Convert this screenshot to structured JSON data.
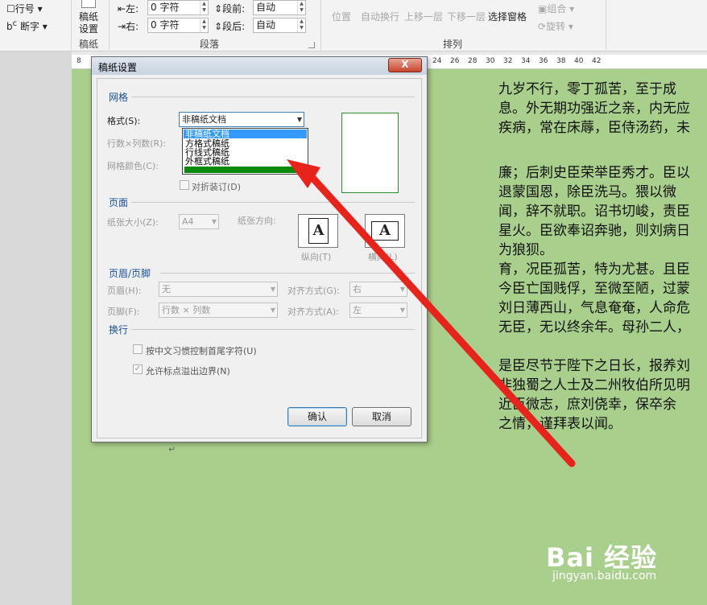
{
  "ribbon": {
    "line_num": "行号",
    "hyphen": "断字",
    "paper_btn_line1": "稿纸",
    "paper_btn_line2": "设置",
    "indent_left_label": "左:",
    "indent_left_value": "0 字符",
    "indent_right_label": "右:",
    "indent_right_value": "0 字符",
    "space_before_label": "段前:",
    "space_before_value": "自动",
    "space_after_label": "段后:",
    "space_after_value": "自动",
    "position": "位置",
    "wrap_text": "自动换行",
    "bring_forward": "上移一层",
    "send_backward": "下移一层",
    "selection_pane": "选择窗格",
    "group_btn": "组合",
    "rotate_btn": "旋转",
    "group_paper": "稿纸",
    "group_paragraph": "段落",
    "group_arrange": "排列"
  },
  "ruler": {
    "marks": [
      "8",
      "24",
      "26",
      "28",
      "30",
      "32",
      "34",
      "36",
      "38",
      "40",
      "42"
    ]
  },
  "document": {
    "lines": [
      "九岁不行，零丁孤苦，至于成",
      "息。外无期功强近之亲，内无应",
      "疾病，常在床蓐，臣侍汤药，未",
      "廉；后刺史臣荣举臣秀才。臣以",
      "退蒙国恩，除臣洗马。猥以微",
      "闻，辞不就职。诏书切峻，责臣",
      "星火。臣欲奉诏奔驰，则刘病日",
      "为狼狈。",
      "育，况臣孤苦，特为尤甚。且臣",
      "今臣亡国贱俘，至微至陋，过蒙",
      "刘日薄西山，气息奄奄，人命危",
      "无臣，无以终余年。母孙二人，",
      "是臣尽节于陛下之日长，报养刘",
      "非独蜀之人士及二州牧伯所见明",
      "近臣微志，庶刘侥幸，保卒余",
      "之情，谨拜表以闻。"
    ]
  },
  "dialog": {
    "title": "稿纸设置",
    "close_label": "X",
    "sections": {
      "grid": "网格",
      "page": "页面",
      "header_footer": "页眉/页脚",
      "line_break": "换行"
    },
    "format_label": "格式(S):",
    "format_value": "非稿纸文档",
    "format_options": [
      "非稿纸文档",
      "方格式稿纸",
      "行线式稿纸",
      "外框式稿纸"
    ],
    "rows_cols_label": "行数×列数(R):",
    "grid_color_label": "网格颜色(C):",
    "fold_binding_label": "对折装订(D)",
    "paper_size_label": "纸张大小(Z):",
    "paper_size_value": "A4",
    "orientation_label": "纸张方向:",
    "portrait_label": "纵向(T)",
    "landscape_label": "横向(L)",
    "orient_glyph": "A",
    "header_label": "页眉(H):",
    "header_value": "无",
    "footer_label": "页脚(F):",
    "footer_value": "行数 × 列数",
    "align_header_label": "对齐方式(G):",
    "align_header_value": "右",
    "align_footer_label": "对齐方式(A):",
    "align_footer_value": "左",
    "opt_punct_control": "按中文习惯控制首尾字符(U)",
    "opt_allow_overflow": "允许标点溢出边界(N)",
    "ok_label": "确认",
    "cancel_label": "取消"
  },
  "watermark": {
    "logo": "Bai 经验",
    "url": "jingyan.baidu.com"
  },
  "colors": {
    "page_bg": "#a9cf8c",
    "arrow": "#e8231c",
    "selection": "#3399ff",
    "section_title": "#1a4f9c"
  }
}
